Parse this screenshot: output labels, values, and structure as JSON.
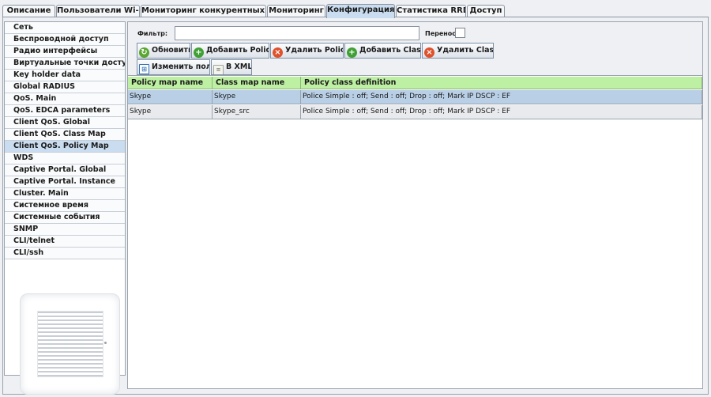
{
  "tabs": [
    {
      "label": "Описание",
      "active": false
    },
    {
      "label": "Пользователи Wi-Fi",
      "active": false
    },
    {
      "label": "Мониторинг конкурентных ТД",
      "active": false
    },
    {
      "label": "Мониторинг",
      "active": false
    },
    {
      "label": "Конфигурация",
      "active": true
    },
    {
      "label": "Статистика RRD",
      "active": false
    },
    {
      "label": "Доступ",
      "active": false
    }
  ],
  "sidebar": {
    "selected": "Client QoS. Policy Map",
    "items": [
      "Сеть",
      "Беспроводной доступ",
      "Радио интерфейсы",
      "Виртуальные точки доступа",
      "Key holder data",
      "Global RADIUS",
      "QoS. Main",
      "QoS. EDCA parameters",
      "Client QoS. Global",
      "Client QoS. Class Map",
      "Client QoS. Policy Map",
      "WDS",
      "Captive Portal. Global",
      "Captive Portal. Instance",
      "Cluster. Main",
      "Системное время",
      "Системные события",
      "SNMP",
      "CLI/telnet",
      "CLI/ssh"
    ]
  },
  "filter": {
    "label": "Фильтр:",
    "value": "",
    "wrap_label": "Перенос",
    "wrap_checked": false
  },
  "toolbar": {
    "refresh": "Обновить",
    "add_policy": "Добавить Policy",
    "delete_policy": "Удалить Policy",
    "add_class": "Добавить Class",
    "delete_class": "Удалить Class",
    "edit_fields": "Изменить поля",
    "to_xml": "В XML"
  },
  "icons": {
    "refresh": "refresh-icon",
    "add": "plus-circle-icon",
    "delete": "delete-circle-icon",
    "edit": "edit-fields-icon",
    "xml": "document-icon"
  },
  "colors": {
    "header_bg": "#bdf0a2",
    "selected_bg": "#b9cfe6",
    "active_tab": "#c9dcf0"
  },
  "table": {
    "columns": [
      "Policy map name",
      "Class map name",
      "Policy class definition"
    ],
    "rows": [
      {
        "policy": "Skype",
        "class": "Skype",
        "definition": "Police Simple : off; Send : off; Drop : off; Mark IP DSCP : EF",
        "selected": true
      },
      {
        "policy": "Skype",
        "class": "Skype_src",
        "definition": "Police Simple : off; Send : off; Drop : off; Mark IP DSCP : EF",
        "selected": false
      }
    ]
  }
}
